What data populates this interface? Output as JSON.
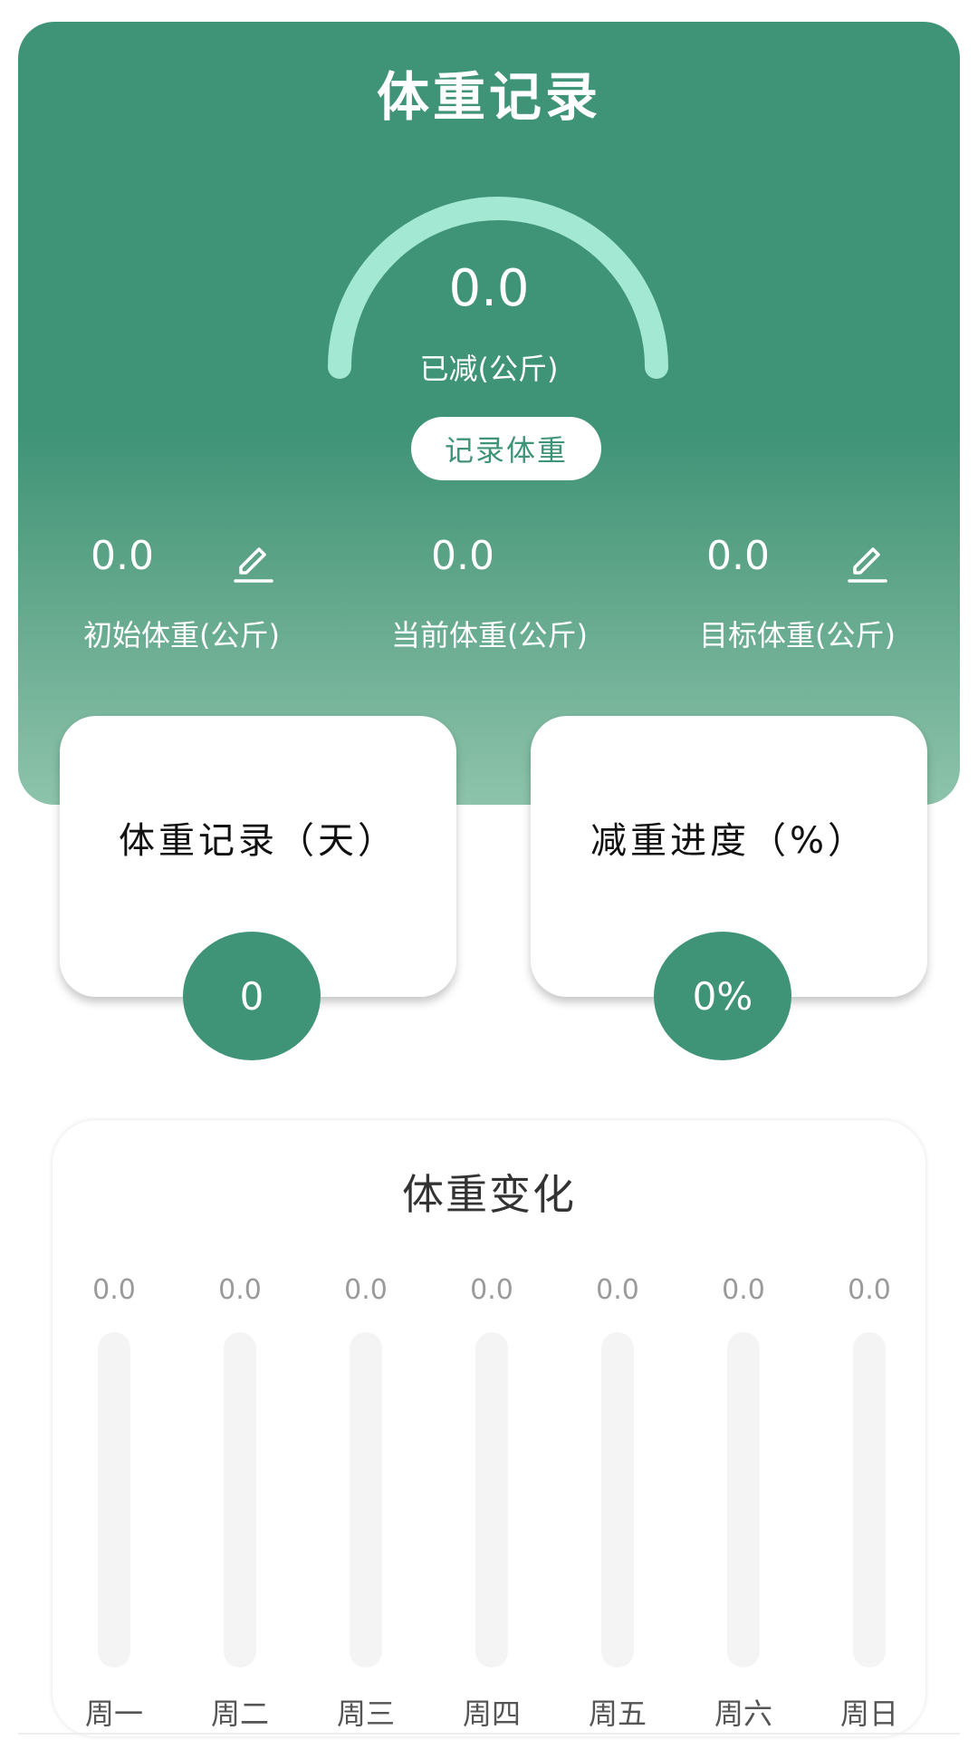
{
  "colors": {
    "primary": "#3f9377",
    "gauge_arc": "#a3e8d2",
    "track": "#f4f4f4"
  },
  "header": {
    "title": "体重记录"
  },
  "gauge": {
    "value": "0.0",
    "label": "已减(公斤)",
    "progress": 0
  },
  "record_button": {
    "label": "记录体重"
  },
  "stats": [
    {
      "value": "0.0",
      "label": "初始体重(公斤)",
      "editable": true,
      "icon": "edit-icon"
    },
    {
      "value": "0.0",
      "label": "当前体重(公斤)",
      "editable": false
    },
    {
      "value": "0.0",
      "label": "目标体重(公斤)",
      "editable": true,
      "icon": "edit-icon"
    }
  ],
  "cards": [
    {
      "title": "体重记录（天）",
      "value": "0"
    },
    {
      "title": "减重进度（%）",
      "value": "0%"
    }
  ],
  "chart_data": {
    "type": "bar",
    "title": "体重变化",
    "categories": [
      "周一",
      "周二",
      "周三",
      "周四",
      "周五",
      "周六",
      "周日"
    ],
    "values": [
      0,
      0,
      0,
      0,
      0,
      0,
      0
    ],
    "value_labels": [
      "0.0",
      "0.0",
      "0.0",
      "0.0",
      "0.0",
      "0.0",
      "0.0"
    ],
    "grid": false
  }
}
